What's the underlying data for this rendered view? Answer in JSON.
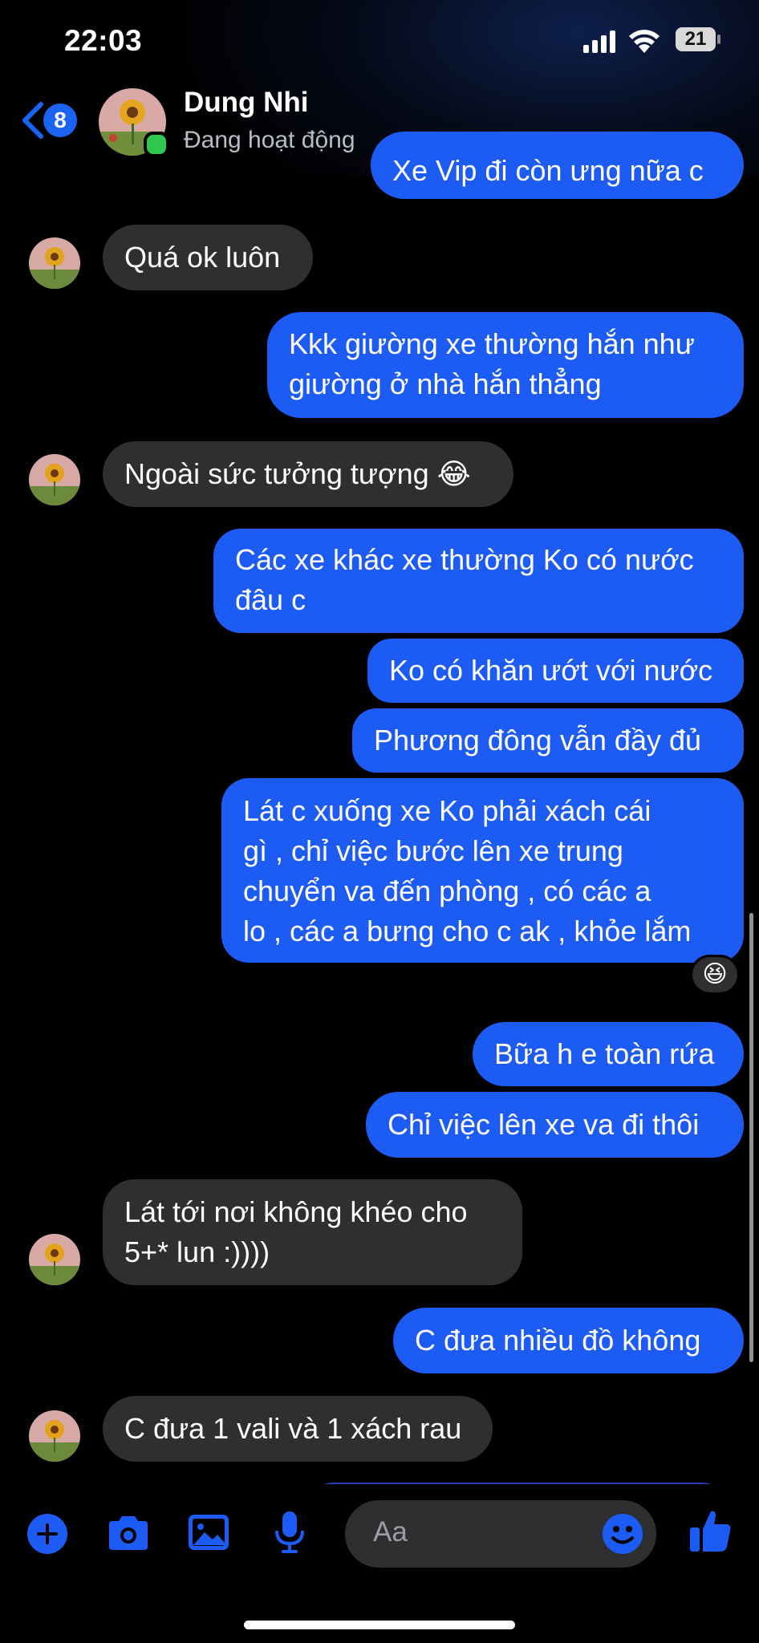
{
  "status_bar": {
    "time": "22:03",
    "battery": "21"
  },
  "header": {
    "back_badge": "8",
    "contact_name": "Dung Nhi",
    "contact_status": "Đang hoạt động"
  },
  "messages": [
    {
      "direction": "out",
      "lines": [
        "Xe Vip đi còn ưng nữa c"
      ]
    },
    {
      "direction": "in",
      "lines": [
        "Quá ok luôn"
      ]
    },
    {
      "direction": "out",
      "lines": [
        "Kkk giường xe thường hắn như",
        "giường ở nhà hắn thẳng"
      ]
    },
    {
      "direction": "in",
      "lines": [
        "Ngoài sức tưởng tượng 😂"
      ]
    },
    {
      "direction": "out",
      "lines": [
        "Các xe khác xe thường Ko có nước",
        "đâu c"
      ]
    },
    {
      "direction": "out",
      "lines": [
        "Ko có khăn ướt với nước"
      ]
    },
    {
      "direction": "out",
      "lines": [
        "Phương đông vẫn đầy đủ"
      ]
    },
    {
      "direction": "out",
      "lines": [
        "Lát c xuống xe Ko phải  xách cái",
        "gì , chỉ việc bước lên xe trung",
        "chuyển va đến phòng , có các a",
        "lo , các a bưng cho c ak , khỏe lắm"
      ],
      "reaction": "😆"
    },
    {
      "direction": "out",
      "lines": [
        "Bữa h e toàn rứa"
      ]
    },
    {
      "direction": "out",
      "lines": [
        "Chỉ việc lên xe va đi thôi"
      ]
    },
    {
      "direction": "in",
      "lines": [
        "Lát tới nơi không khéo cho",
        "5+* lun :))))"
      ]
    },
    {
      "direction": "out",
      "lines": [
        "C đưa nhiều đồ không"
      ]
    },
    {
      "direction": "in",
      "lines": [
        "C đưa 1 vali và 1 xách rau"
      ]
    }
  ],
  "composer": {
    "placeholder": "Aa"
  },
  "icons": {
    "back": "chevron-left-icon",
    "add": "plus-circle-icon",
    "camera": "camera-icon",
    "gallery": "image-icon",
    "mic": "microphone-icon",
    "emoji": "smiley-icon",
    "like": "thumbs-up-icon"
  },
  "colors": {
    "accent": "#1d5bf5",
    "incoming_bubble": "#2f2f31",
    "background": "#000000",
    "online": "#2fc84c"
  }
}
